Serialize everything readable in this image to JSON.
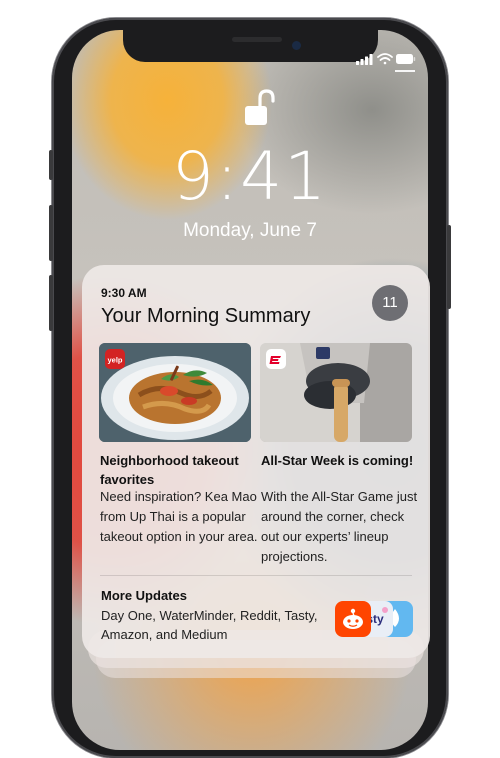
{
  "lock_screen": {
    "time": "9:41",
    "date": "Monday, June 7"
  },
  "notification": {
    "time": "9:30 AM",
    "title": "Your Morning Summary",
    "count": "11",
    "stories": [
      {
        "headline": "Neighborhood takeout favorites",
        "body": "Need inspiration? Kea Mao from Up Thai is a popular takeout option in your area.",
        "app_icon": "yelp-icon"
      },
      {
        "headline": "All-Star Week is coming!",
        "body": "With the All-Star Game just around the corner, check out our experts’ lineup projections.",
        "app_icon": "espn-icon"
      }
    ],
    "more_updates": {
      "title": "More Updates",
      "apps": "Day One, WaterMinder, Reddit, Tasty, Amazon, and Medium",
      "icons": [
        "reddit-icon",
        "tasty-icon",
        "waterminder-icon"
      ]
    }
  },
  "colors": {
    "card_bg": "#eee8e6",
    "badge_bg": "#6e6e73",
    "yelp_red": "#d32323",
    "espn_red": "#e4002b",
    "reddit_orange": "#ff4500"
  }
}
